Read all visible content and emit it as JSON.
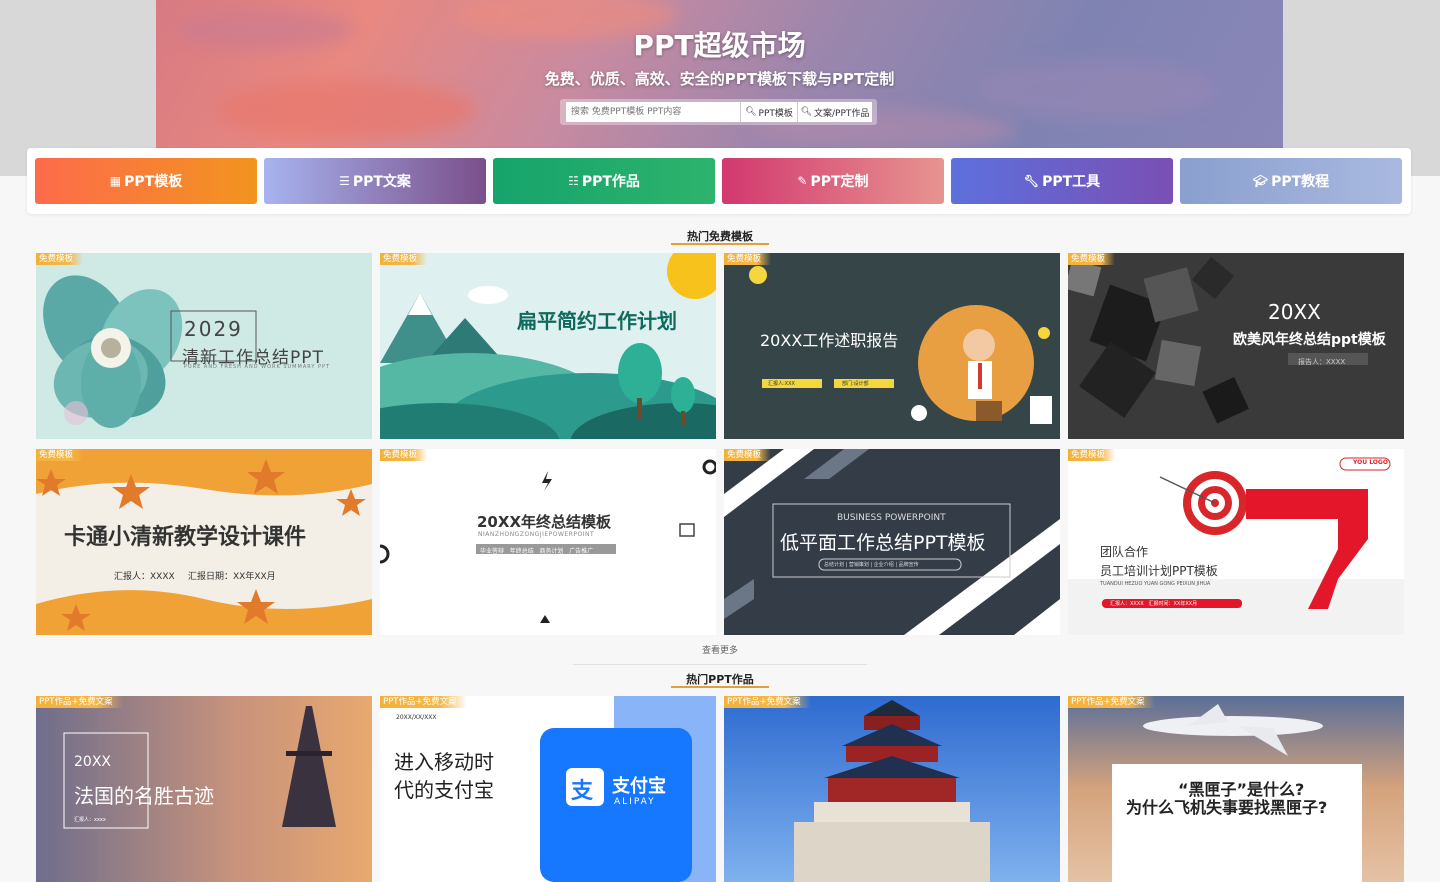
{
  "hero": {
    "title": "PPT超级市场",
    "subtitle": "免费、优质、高效、安全的PPT模板下载与PPT定制",
    "search_placeholder": "搜索 免费PPT模板 PPT内容",
    "search_btn1": "PPT模板",
    "search_btn2": "文案/PPT作品"
  },
  "categories": [
    {
      "label": "PPT模板",
      "icon": "grid-icon",
      "color": "#f8703e"
    },
    {
      "label": "PPT文案",
      "icon": "list-icon",
      "color": "#8f7fbd"
    },
    {
      "label": "PPT作品",
      "icon": "th-list-icon",
      "color": "#1fae6c"
    },
    {
      "label": "PPT定制",
      "icon": "edit-icon",
      "color": "#d8457a"
    },
    {
      "label": "PPT工具",
      "icon": "wrench-icon",
      "color": "#5f6fdc"
    },
    {
      "label": "PPT教程",
      "icon": "graduation-cap-icon",
      "color": "#8fa3d2"
    }
  ],
  "section1": {
    "title": "热门免费模板",
    "tag": "免费模板",
    "cards": [
      {
        "t1": "2029",
        "t2": "清新工作总结PPT",
        "t3": "PURE AND FRESH AND WORK SUMMARY PPT"
      },
      {
        "t1": "扁平简约工作计划"
      },
      {
        "t1": "20XX工作述职报告",
        "t2": "汇报人:XXX",
        "t3": "部门:设计部"
      },
      {
        "t1": "20XX",
        "t2": "欧美风年终总结ppt模板",
        "t3": "报告人：XXXX"
      },
      {
        "t1": "卡通小清新教学设计课件",
        "t2": "汇报人：XXXX",
        "t3": "汇报日期：XX年XX月"
      },
      {
        "t1": "20XX年终总结模板",
        "t2": "NIANZHONGZONGJIEPOWERPOINT",
        "t3": "毕业答辩   年终总结   商务计划   广告推广"
      },
      {
        "t1": "BUSINESS POWERPOINT",
        "t2": "低平面工作总结PPT模板",
        "t3": "总结计划 | 营销策划 | 企业介绍 | 品牌宣传"
      },
      {
        "t1": "YOU LOGO",
        "t2": "团队合作",
        "t3": "员工培训计划PPT模板",
        "t4": "TUANDUI HEZUO YUAN GONG PEIXUN JIHUA",
        "t5": "汇报人：XXXX   汇报时间：XX年XX月"
      }
    ],
    "more": "查看更多"
  },
  "section2": {
    "title": "热门PPT作品",
    "tag": "PPT作品+免费文案",
    "cards": [
      {
        "t1": "20XX",
        "t2": "法国的名胜古迹",
        "t3": "汇报人：xxxx"
      },
      {
        "t1": "20XX/XX/XXX",
        "t2": "进入移动时",
        "t3": "代的支付宝",
        "logo_text": "支付宝",
        "logo_sub": "ALIPAY"
      },
      {},
      {
        "t1": "“黑匣子”是什么?",
        "t2": "为什么飞机失事要找黑匣子?"
      }
    ]
  }
}
